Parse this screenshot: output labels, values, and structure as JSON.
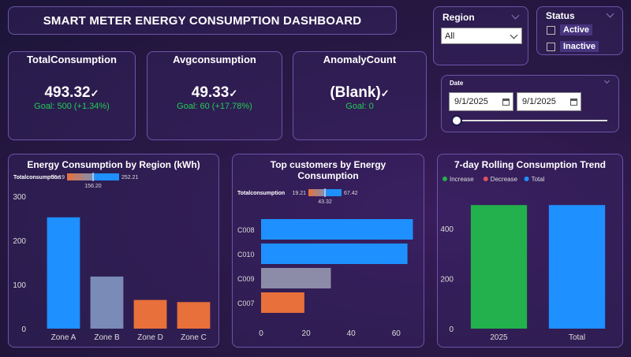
{
  "header": {
    "title": "SMART METER ENERGY CONSUMPTION DASHBOARD"
  },
  "slicers": {
    "region": {
      "label": "Region",
      "selected": "All"
    },
    "status": {
      "label": "Status",
      "options": [
        "Active",
        "Inactive"
      ]
    },
    "date": {
      "label": "Date",
      "start": "9/1/2025",
      "end": "9/1/2025"
    }
  },
  "kpis": [
    {
      "title": "TotalConsumption",
      "value": "493.32",
      "goal": "Goal: 500 (+1.34%)"
    },
    {
      "title": "Avgconsumption",
      "value": "49.33",
      "goal": "Goal: 60 (+17.78%)"
    },
    {
      "title": "AnomalyCount",
      "value": "(Blank)",
      "goal": "Goal: 0"
    }
  ],
  "colors": {
    "blue": "#1e90ff",
    "slate": "#7a8bb8",
    "orange": "#e8703a",
    "green": "#22b14c",
    "red": "#e05060",
    "gray": "#8c8ca8"
  },
  "chart_data": [
    {
      "type": "bar",
      "title": "Energy Consumption by Region (kWh)",
      "categories": [
        "Zone A",
        "Zone B",
        "Zone D",
        "Zone C"
      ],
      "values": [
        252.21,
        118,
        65,
        60.19
      ],
      "colors": [
        "#1e90ff",
        "#7a8bb8",
        "#e8703a",
        "#e8703a"
      ],
      "yticks": [
        0,
        100,
        200,
        300
      ],
      "ylim": [
        0,
        300
      ],
      "legend": {
        "label": "Totalconsumption",
        "min": "60.19",
        "mid": "156.20",
        "max": "252.21"
      }
    },
    {
      "type": "bar",
      "orientation": "horizontal",
      "title": "Top customers by Energy Consumption",
      "categories": [
        "C008",
        "C010",
        "C009",
        "C007"
      ],
      "values": [
        67.42,
        65,
        31,
        19.21
      ],
      "colors": [
        "#1e90ff",
        "#1e90ff",
        "#8c8ca8",
        "#e8703a"
      ],
      "xticks": [
        0,
        20,
        40,
        60
      ],
      "xlim": [
        0,
        69
      ],
      "legend": {
        "label": "Totalconsumption",
        "min": "19.21",
        "mid": "43.32",
        "max": "67.42"
      }
    },
    {
      "type": "bar",
      "subtype": "waterfall",
      "title": "7-day Rolling Consumption Trend",
      "categories": [
        "2025",
        "Total"
      ],
      "values": [
        493.32,
        493.32
      ],
      "colors": [
        "#22b14c",
        "#1e90ff"
      ],
      "legend": [
        "Increase",
        "Decrease",
        "Total"
      ],
      "legend_colors": [
        "#22b14c",
        "#e05060",
        "#1e90ff"
      ],
      "yticks": [
        0,
        200,
        400
      ],
      "ylim": [
        0,
        560
      ]
    }
  ]
}
